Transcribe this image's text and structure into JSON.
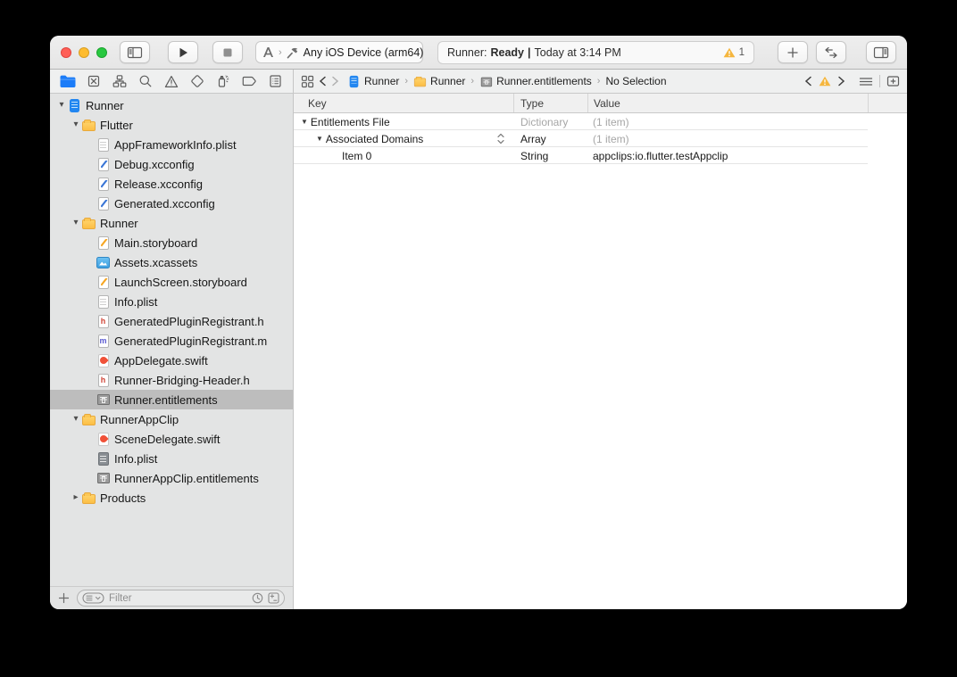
{
  "titlebar": {
    "scheme_selector": {
      "destination_label": "Any iOS Device (arm64)"
    },
    "status": {
      "project": "Runner:",
      "state": "Ready",
      "separator": "|",
      "time": "Today at 3:14 PM",
      "warning_count": "1"
    }
  },
  "navigator_tabs": [
    {
      "icon": "project-navigator-icon",
      "selected": true
    },
    {
      "icon": "source-control-navigator-icon",
      "selected": false
    },
    {
      "icon": "symbol-navigator-icon",
      "selected": false
    },
    {
      "icon": "find-navigator-icon",
      "selected": false
    },
    {
      "icon": "issue-navigator-icon",
      "selected": false
    },
    {
      "icon": "test-navigator-icon",
      "selected": false
    },
    {
      "icon": "debug-navigator-icon",
      "selected": false
    },
    {
      "icon": "breakpoint-navigator-icon",
      "selected": false
    },
    {
      "icon": "report-navigator-icon",
      "selected": false
    }
  ],
  "jumpbar": {
    "segments": [
      {
        "icon": "project-file",
        "label": "Runner"
      },
      {
        "icon": "folder",
        "label": "Runner"
      },
      {
        "icon": "entitlements",
        "label": "Runner.entitlements"
      },
      {
        "icon": null,
        "label": "No Selection"
      }
    ]
  },
  "sidebar": {
    "tree": [
      {
        "depth": 0,
        "icon": "project-file",
        "label": "Runner",
        "disclosure": "expanded"
      },
      {
        "depth": 1,
        "icon": "folder",
        "label": "Flutter",
        "disclosure": "expanded"
      },
      {
        "depth": 2,
        "icon": "plist",
        "label": "AppFrameworkInfo.plist"
      },
      {
        "depth": 2,
        "icon": "xcconfig",
        "label": "Debug.xcconfig"
      },
      {
        "depth": 2,
        "icon": "xcconfig",
        "label": "Release.xcconfig"
      },
      {
        "depth": 2,
        "icon": "xcconfig",
        "label": "Generated.xcconfig"
      },
      {
        "depth": 1,
        "icon": "folder",
        "label": "Runner",
        "disclosure": "expanded"
      },
      {
        "depth": 2,
        "icon": "storyboard",
        "label": "Main.storyboard"
      },
      {
        "depth": 2,
        "icon": "xcassets",
        "label": "Assets.xcassets"
      },
      {
        "depth": 2,
        "icon": "storyboard",
        "label": "LaunchScreen.storyboard"
      },
      {
        "depth": 2,
        "icon": "plist",
        "label": "Info.plist"
      },
      {
        "depth": 2,
        "icon": "header-file",
        "label": "GeneratedPluginRegistrant.h"
      },
      {
        "depth": 2,
        "icon": "objc-file",
        "label": "GeneratedPluginRegistrant.m"
      },
      {
        "depth": 2,
        "icon": "swift-file",
        "label": "AppDelegate.swift"
      },
      {
        "depth": 2,
        "icon": "header-file",
        "label": "Runner-Bridging-Header.h"
      },
      {
        "depth": 2,
        "icon": "entitlements",
        "label": "Runner.entitlements",
        "selected": true
      },
      {
        "depth": 1,
        "icon": "folder",
        "label": "RunnerAppClip",
        "disclosure": "expanded"
      },
      {
        "depth": 2,
        "icon": "swift-file",
        "label": "SceneDelegate.swift"
      },
      {
        "depth": 2,
        "icon": "plist-dark",
        "label": "Info.plist"
      },
      {
        "depth": 2,
        "icon": "entitlements",
        "label": "RunnerAppClip.entitlements"
      },
      {
        "depth": 1,
        "icon": "folder",
        "label": "Products",
        "disclosure": "collapsed"
      }
    ],
    "filter_placeholder": "Filter"
  },
  "editor": {
    "columns": [
      "Key",
      "Type",
      "Value"
    ],
    "rows": [
      {
        "depth": 0,
        "disclosure": true,
        "key": "Entitlements File",
        "type": "Dictionary",
        "value": "(1 item)",
        "type_muted": true,
        "value_muted": true,
        "stepper": false
      },
      {
        "depth": 1,
        "disclosure": true,
        "key": "Associated Domains",
        "type": "Array",
        "value": "(1 item)",
        "type_muted": false,
        "value_muted": true,
        "stepper": true
      },
      {
        "depth": 2,
        "disclosure": false,
        "key": "Item 0",
        "type": "String",
        "value": "appclips:io.flutter.testAppclip",
        "type_muted": false,
        "value_muted": false,
        "stepper": false
      }
    ]
  },
  "colors": {
    "accent_blue": "#2286f0",
    "folder_yellow": "#fcbe45",
    "warning_yellow": "#f5b63e",
    "selection_gray": "#bdbdbd"
  }
}
